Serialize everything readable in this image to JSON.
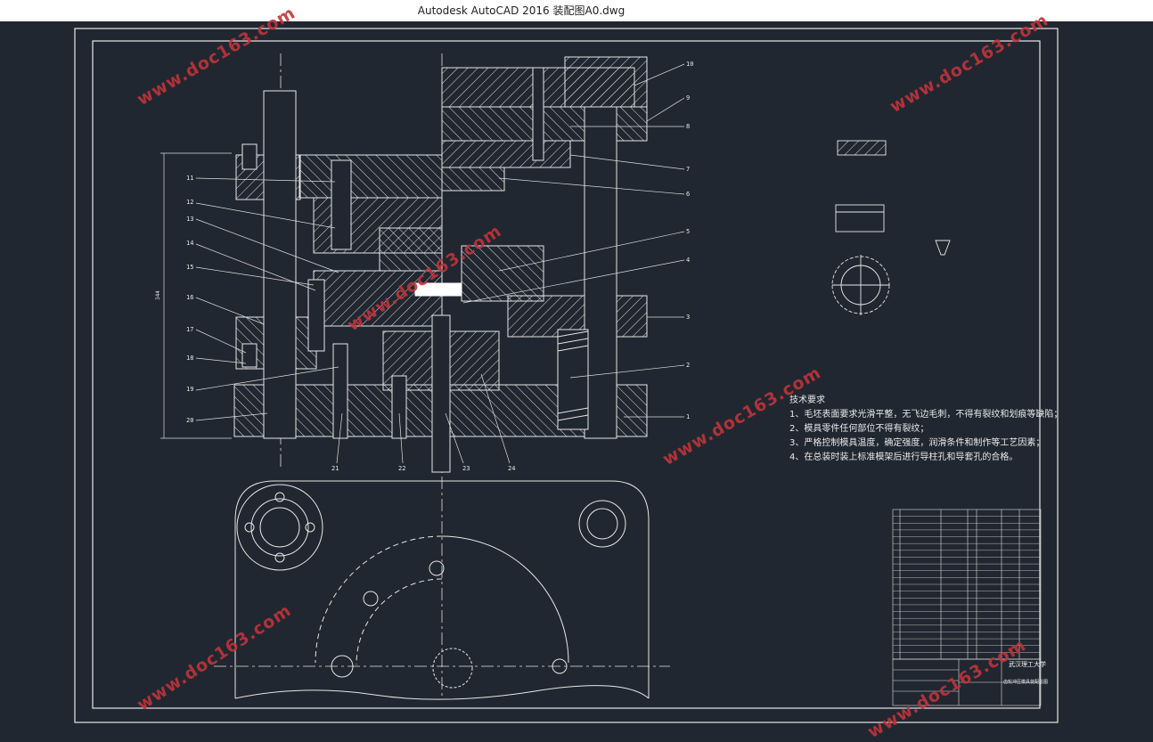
{
  "window": {
    "title": "Autodesk AutoCAD 2016      装配图A0.dwg"
  },
  "watermark": {
    "text": "www.doc163.com",
    "color": "#c0343a"
  },
  "drawing": {
    "background": "#212730",
    "line_color": "#e0e0e0",
    "part_numbers_right": [
      "10",
      "9",
      "8",
      "7",
      "6",
      "5",
      "4",
      "3",
      "2",
      "1"
    ],
    "part_numbers_left": [
      "11",
      "12",
      "13",
      "14",
      "15",
      "16",
      "17",
      "18",
      "19",
      "20"
    ],
    "part_numbers_bottom": [
      "21",
      "22",
      "23",
      "24"
    ],
    "overall_dimension": "344"
  },
  "technical_requirements": {
    "heading": "技术要求",
    "items": [
      "1、毛坯表面要求光滑平整，无飞边毛刺，不得有裂纹和划痕等缺陷；",
      "2、模具零件任何部位不得有裂纹；",
      "3、严格控制模具温度，确定强度，润滑条件和制作等工艺因素；",
      "4、在总装时装上标准模架后进行导柱孔和导套孔的合格。"
    ]
  },
  "title_block": {
    "school": "武汉理工大学",
    "drawing_name": "齿轮冲压模具装配总图"
  }
}
